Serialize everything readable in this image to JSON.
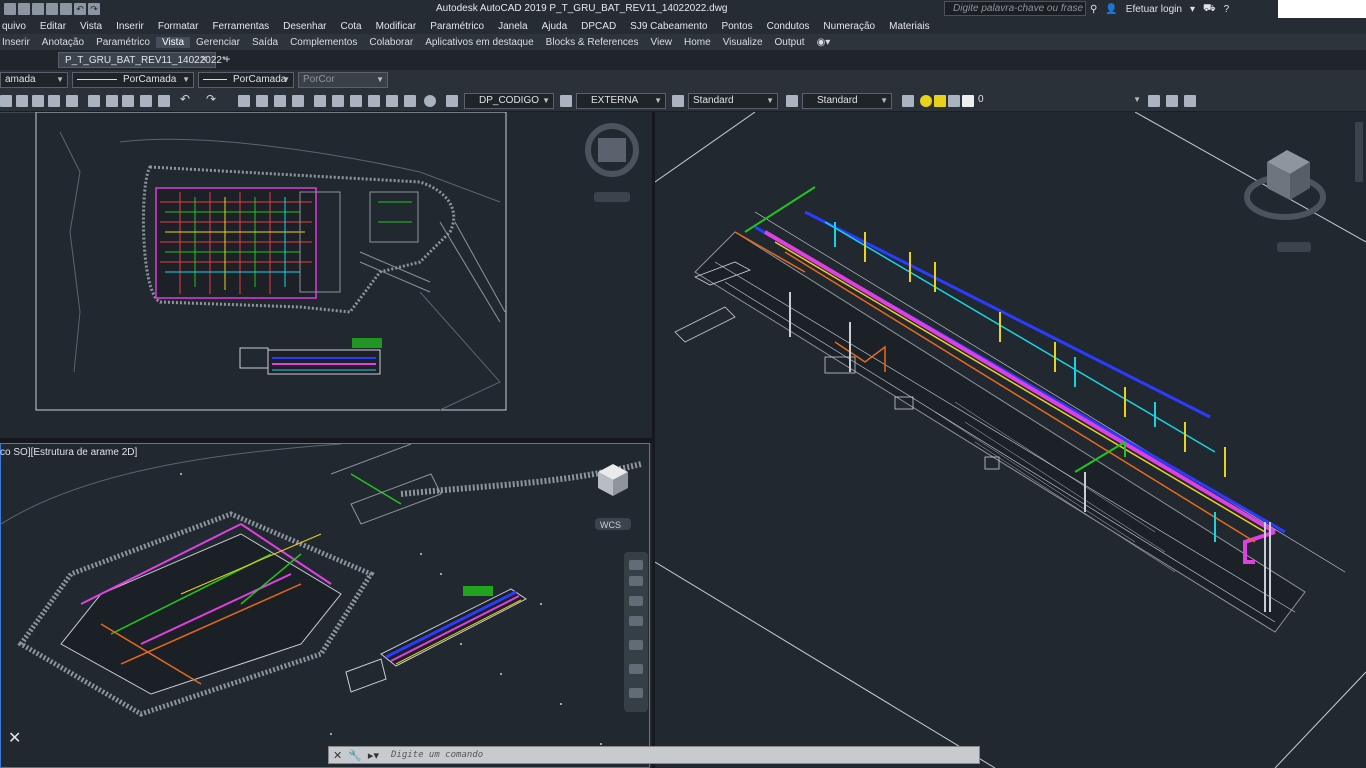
{
  "window": {
    "title": "Autodesk AutoCAD 2019    P_T_GRU_BAT_REV11_14022022.dwg",
    "search_placeholder": "Digite palavra-chave ou frase",
    "login_label": "Efetuar login"
  },
  "menu": [
    "quivo",
    "Editar",
    "Vista",
    "Inserir",
    "Formatar",
    "Ferramentas",
    "Desenhar",
    "Cota",
    "Modificar",
    "Paramétrico",
    "Janela",
    "Ajuda",
    "DPCAD",
    "SJ9 Cabeamento",
    "Pontos",
    "Condutos",
    "Numeração",
    "Materiais"
  ],
  "ribbon_tabs": [
    "Inserir",
    "Anotação",
    "Paramétrico",
    "Vista",
    "Gerenciar",
    "Saída",
    "Complementos",
    "Colaborar",
    "Aplicativos em destaque",
    "Blocks & References",
    "View",
    "Home",
    "Visualize",
    "Output"
  ],
  "ribbon_active": "Vista",
  "document_tab": "P_T_GRU_BAT_REV11_14022022*",
  "properties": {
    "layer": "amada",
    "linetype": "PorCamada",
    "lineweight": "PorCamada",
    "color": "PorCor"
  },
  "styles": {
    "text_style": "DP_CODIGO",
    "dim_style": "EXTERNA",
    "table_style": "Standard",
    "mleader_style": "Standard",
    "layer_current": "0"
  },
  "viewports": {
    "bottom_left_label": "co SO][Estrutura de arame 2D]",
    "wcs_label": "WCS"
  },
  "command_line": {
    "placeholder": "Digite um comando"
  },
  "icons": [
    "save-icon",
    "print-icon",
    "undo-icon",
    "redo-icon",
    "pan-icon",
    "zoom-icon",
    "layer-icon",
    "search-icon",
    "user-icon",
    "cart-icon",
    "help-icon",
    "close-icon",
    "view-cube-icon",
    "navigation-bar-icon",
    "ucs-icon"
  ],
  "colors": {
    "background": "#212830",
    "active_viewport_border": "#3a7bd5",
    "pipe_magenta": "#e040e0",
    "pipe_blue": "#2a3cff",
    "pipe_yellow": "#e8d21a",
    "pipe_cyan": "#19d4e0",
    "pipe_green": "#22c41e",
    "pipe_orange": "#e86a1a"
  }
}
